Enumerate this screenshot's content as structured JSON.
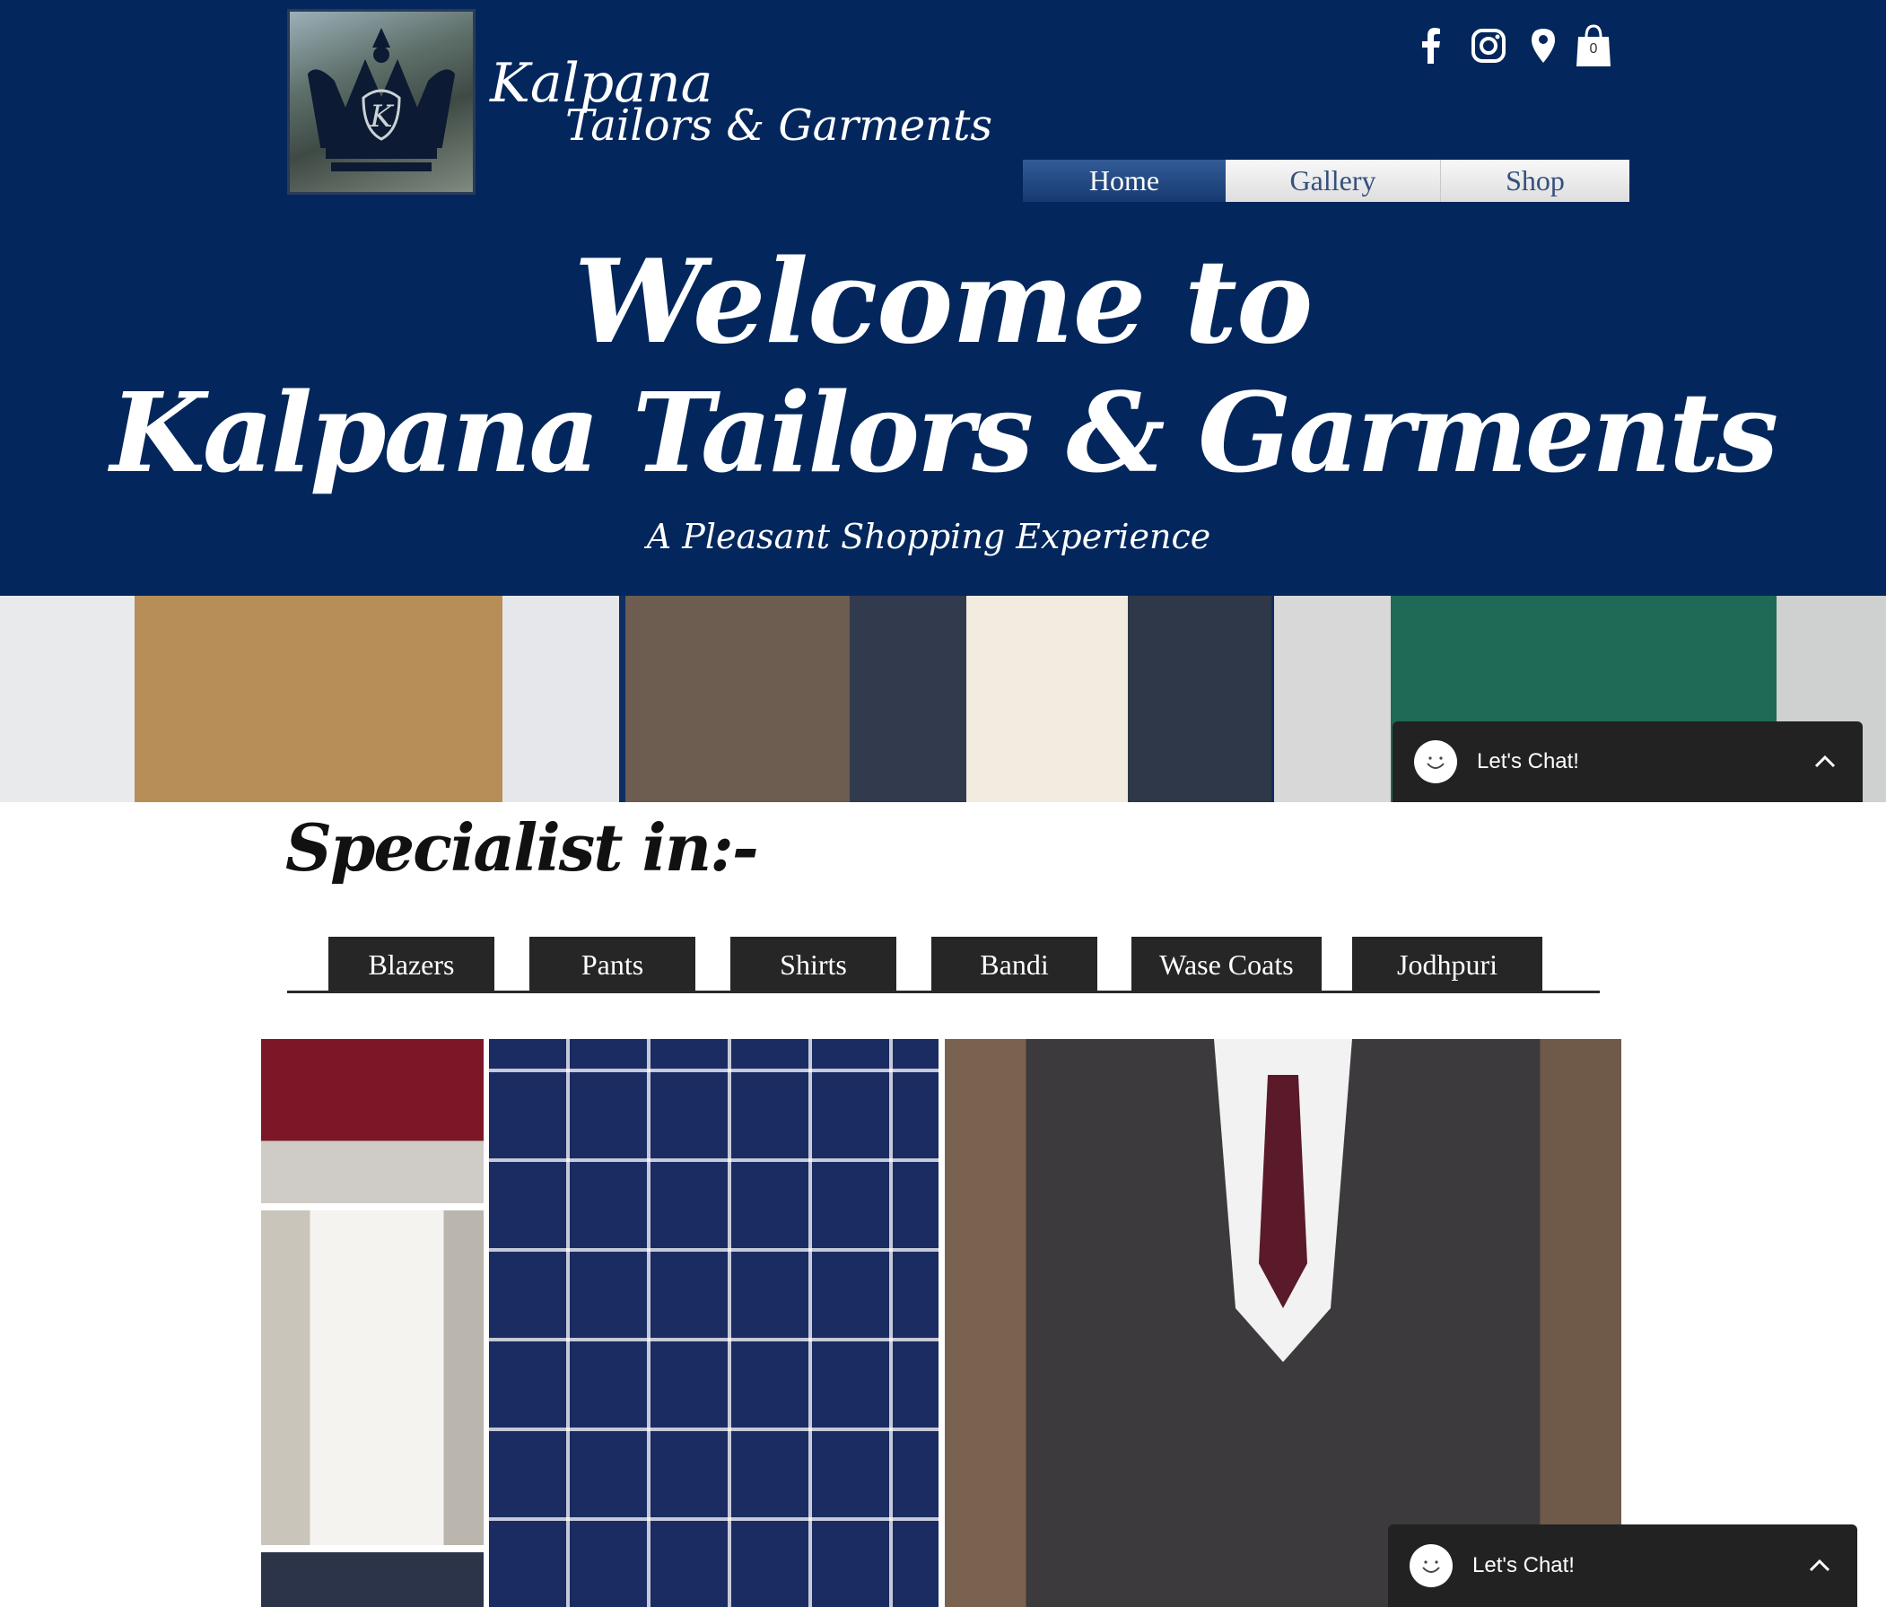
{
  "brand": {
    "line1": "Kalpana",
    "line2": "Tailors & Garments",
    "logo_letter": "K"
  },
  "social": {
    "icons": [
      "facebook-icon",
      "instagram-icon",
      "map-pin-icon",
      "shopping-bag-icon"
    ],
    "cart_count": "0"
  },
  "nav": {
    "items": [
      {
        "label": "Home",
        "active": true
      },
      {
        "label": "Gallery",
        "active": false
      },
      {
        "label": "Shop",
        "active": false
      }
    ]
  },
  "hero": {
    "welcome_line1": "Welcome to",
    "welcome_line2": "Kalpana Tailors & Garments",
    "tagline": "A Pleasant Shopping Experience"
  },
  "chat": {
    "label": "Let's Chat!"
  },
  "specialist": {
    "heading": "Specialist in:-",
    "tabs": [
      "Blazers",
      "Pants",
      "Shirts",
      "Bandi",
      "Wase Coats",
      "Jodhpuri"
    ]
  },
  "colors": {
    "header_bg": "#03275c",
    "nav_active": "#234a86",
    "tab_bg": "#262626",
    "chat_bg": "#222222"
  }
}
